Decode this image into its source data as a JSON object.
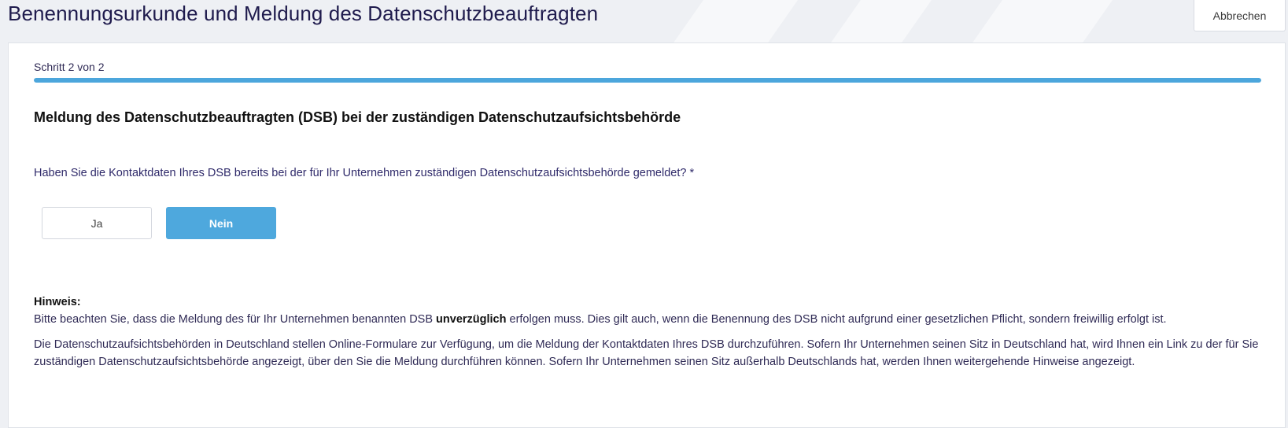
{
  "header": {
    "title": "Benennungsurkunde und Meldung des Datenschutzbeauftragten",
    "cancel_label": "Abbrechen"
  },
  "wizard": {
    "step_label": "Schritt 2 von 2",
    "progress_fraction": 1.0,
    "accent_color": "#4ca6dc"
  },
  "form": {
    "section_title": "Meldung des Datenschutzbeauftragten (DSB) bei der zuständigen Datenschutzaufsichtsbehörde",
    "question": "Haben Sie die Kontaktdaten Ihres DSB bereits bei der für Ihr Unternehmen zuständigen Datenschutzaufsichtsbehörde gemeldet? *",
    "options": [
      {
        "label": "Ja",
        "selected": false
      },
      {
        "label": "Nein",
        "selected": true
      }
    ]
  },
  "hint": {
    "heading": "Hinweis:",
    "para1_before": "Bitte beachten Sie, dass die Meldung des für Ihr Unternehmen benannten DSB ",
    "para1_bold": "unverzüglich",
    "para1_after": " erfolgen muss. Dies gilt auch, wenn die Benennung des DSB nicht aufgrund einer gesetzlichen Pflicht, sondern freiwillig erfolgt ist.",
    "para2": "Die Datenschutzaufsichtsbehörden in Deutschland stellen Online-Formulare zur Verfügung, um die Meldung der Kontaktdaten Ihres DSB durchzuführen. Sofern Ihr Unternehmen seinen Sitz in Deutschland hat, wird Ihnen ein Link zu der für Sie zuständigen Datenschutzaufsichtsbehörde angezeigt, über den Sie die Meldung durchführen können. Sofern Ihr Unternehmen seinen Sitz außerhalb Deutschlands hat, werden Ihnen weitergehende Hinweise angezeigt."
  }
}
